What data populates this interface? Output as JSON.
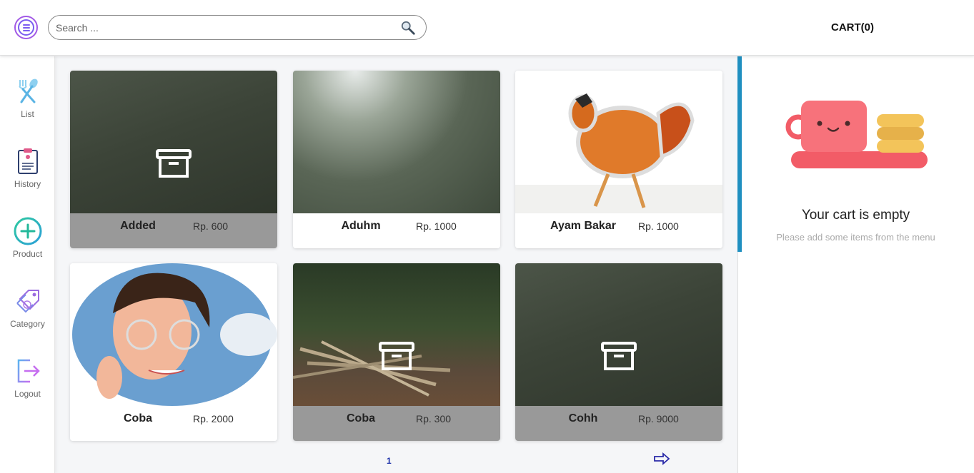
{
  "header": {
    "search_placeholder": "Search ...",
    "cart_title": "CART(0)"
  },
  "sidebar": {
    "items": [
      {
        "label": "List",
        "icon": "fork-spoon-icon"
      },
      {
        "label": "History",
        "icon": "clipboard-icon"
      },
      {
        "label": "Product",
        "icon": "plus-circle-icon"
      },
      {
        "label": "Category",
        "icon": "tag-icon"
      },
      {
        "label": "Logout",
        "icon": "logout-icon"
      }
    ]
  },
  "products": [
    {
      "name": "Added",
      "price": "Rp. 600"
    },
    {
      "name": "Aduhm",
      "price": "Rp. 1000"
    },
    {
      "name": "Ayam Bakar",
      "price": "Rp. 1000"
    },
    {
      "name": "Coba",
      "price": "Rp. 2000"
    },
    {
      "name": "Coba",
      "price": "Rp. 300"
    },
    {
      "name": "Cohh",
      "price": "Rp. 9000"
    }
  ],
  "pagination": {
    "current_page": "1"
  },
  "cart": {
    "empty_title": "Your cart is empty",
    "empty_subtitle": "Please add some items from the menu"
  },
  "colors": {
    "accent": "#1f8fc0",
    "menu_purple": "#a259e6",
    "cup_red": "#f25c67",
    "cookie_yellow": "#f3c45a"
  }
}
